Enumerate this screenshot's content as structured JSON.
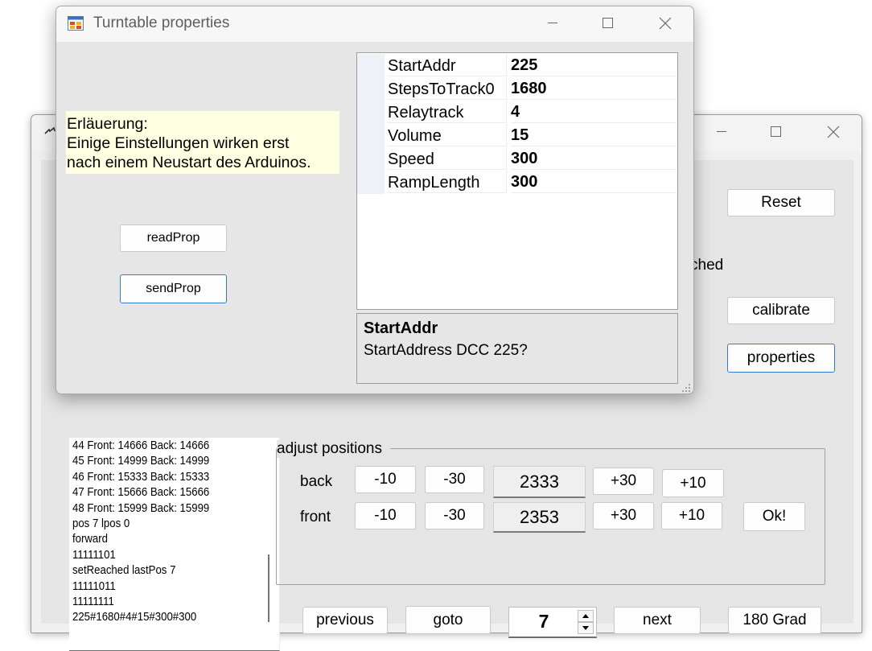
{
  "main": {
    "buttons": {
      "reset": "Reset",
      "calibrate": "calibrate",
      "properties": "properties",
      "previous": "previous",
      "goto": "goto",
      "next": "next",
      "grad180": "180 Grad",
      "ok": "Ok!"
    },
    "partial_label": "ched",
    "log_lines": [
      "44 Front: 14666 Back: 14666",
      "45 Front: 14999 Back: 14999",
      "46 Front: 15333 Back: 15333",
      "47 Front: 15666 Back: 15666",
      "48 Front: 15999 Back: 15999",
      "pos 7  lpos 0",
      "forward",
      "11111101",
      "setReached lastPos 7",
      "11111011",
      "11111111",
      "225#1680#4#15#300#300"
    ],
    "adjust": {
      "title": "adjust positions",
      "back": {
        "label": "back",
        "minus10": "-10",
        "minus30": "-30",
        "value": "2333",
        "plus30": "+30",
        "plus10": "+10"
      },
      "front": {
        "label": "front",
        "minus10": "-10",
        "minus30": "-30",
        "value": "2353",
        "plus30": "+30",
        "plus10": "+10"
      }
    },
    "position_value": "7"
  },
  "dialog": {
    "title": "Turntable properties",
    "explanation": {
      "line1": "Erläuerung:",
      "line2": "Einige Einstellungen wirken erst",
      "line3": "nach einem Neustart des Arduinos."
    },
    "buttons": {
      "read": "readProp",
      "send": "sendProp"
    },
    "properties": [
      {
        "name": "StartAddr",
        "value": "225"
      },
      {
        "name": "StepsToTrack0",
        "value": "1680"
      },
      {
        "name": "Relaytrack",
        "value": "4"
      },
      {
        "name": "Volume",
        "value": "15"
      },
      {
        "name": "Speed",
        "value": "300"
      },
      {
        "name": "RampLength",
        "value": "300"
      }
    ],
    "description": {
      "name": "StartAddr",
      "text": "StartAddress DCC 225?"
    }
  },
  "icons": {
    "minimize": "minimize-icon",
    "maximize": "maximize-icon",
    "close": "close-icon",
    "app": "app-icon",
    "spin_up": "spin-up-icon",
    "spin_down": "spin-down-icon",
    "resize_grip": "resize-grip-icon"
  },
  "colors": {
    "focus_border": "#2f7cd3",
    "hint_background": "#ffffe1"
  }
}
